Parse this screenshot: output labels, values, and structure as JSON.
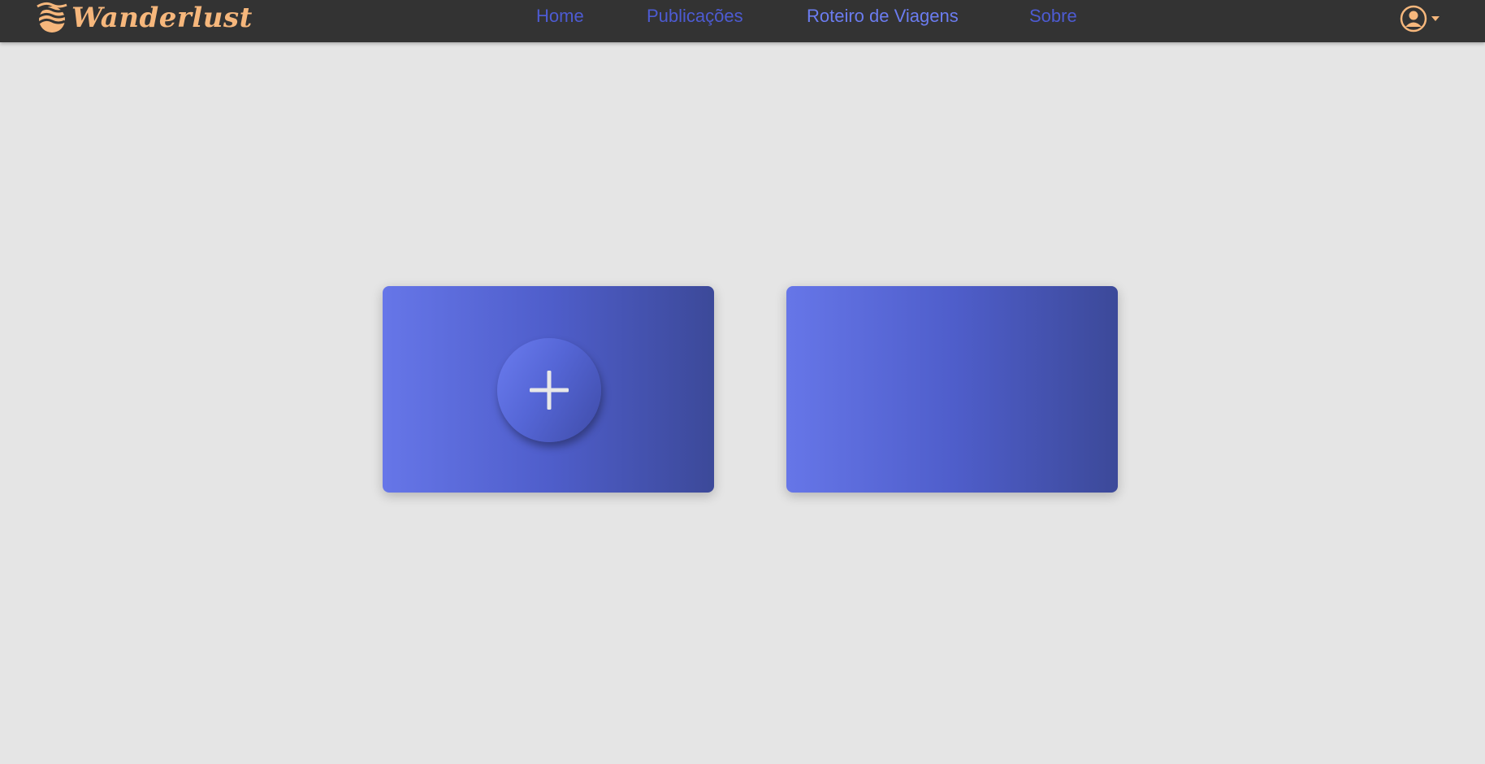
{
  "header": {
    "brand": "Wanderlust",
    "logo_icon": "sun-waves-icon",
    "brand_color": "#f6b77c",
    "nav": [
      {
        "label": "Home",
        "active": false
      },
      {
        "label": "Publicações",
        "active": false
      },
      {
        "label": "Roteiro de Viagens",
        "active": true
      },
      {
        "label": "Sobre",
        "active": false
      }
    ],
    "profile_icon": "user-circle-icon",
    "dropdown_icon": "caret-down-icon"
  },
  "main": {
    "cards": [
      {
        "icon": "plus-icon",
        "action": "add"
      },
      {}
    ]
  },
  "colors": {
    "background": "#e5e5e5",
    "topbar": "#333333",
    "nav_link": "#4d5bd2",
    "nav_active": "#6b7cf0",
    "card_gradient_start": "#6676e8",
    "card_gradient_end": "#3c4999"
  }
}
